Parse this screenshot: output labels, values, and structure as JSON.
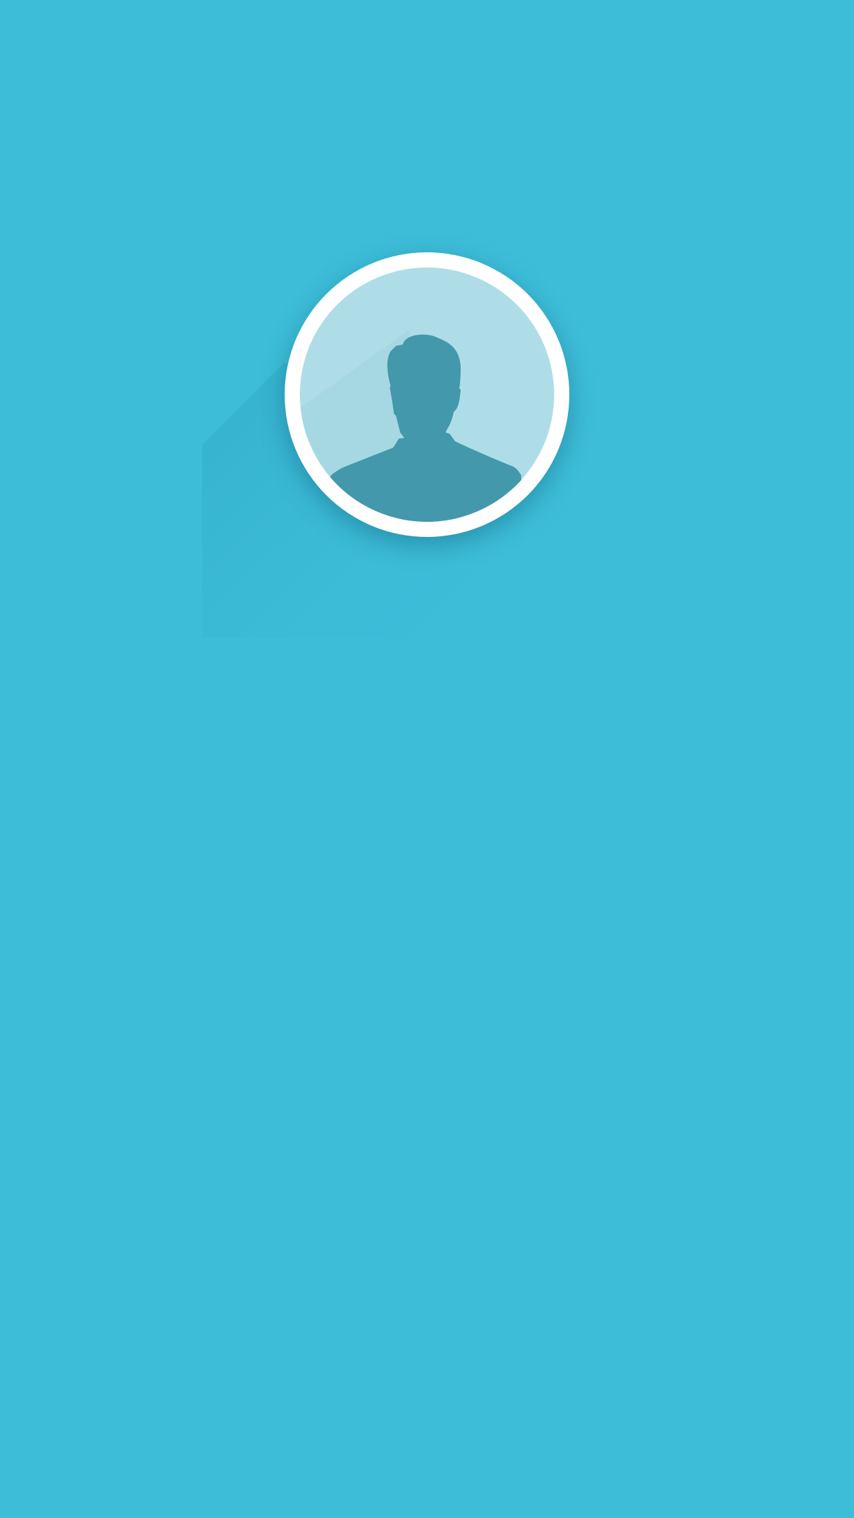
{
  "screen": {
    "background_color": "#3dbdd8"
  },
  "avatar": {
    "icon": "user-silhouette-icon",
    "ring_color": "#ffffff",
    "fill_color": "#aedde7",
    "silhouette_color": "#4398ab"
  }
}
